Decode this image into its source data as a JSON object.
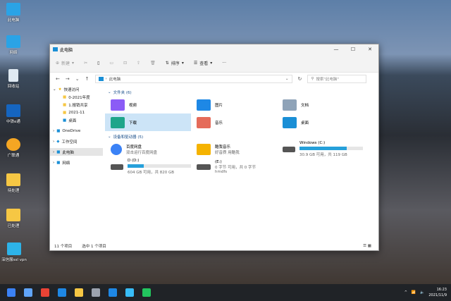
{
  "desktop": {
    "icons": [
      {
        "label": "此电脑",
        "color": "#2aa3e6"
      },
      {
        "label": "网络",
        "color": "#2aa3e6"
      },
      {
        "label": "回收站",
        "color": "#dfe9f2"
      },
      {
        "label": "中铁e通",
        "color": "#1565c0"
      },
      {
        "label": "广联通",
        "color": "#f5a623"
      },
      {
        "label": "待处理",
        "color": "#f6c744"
      },
      {
        "label": "已处理",
        "color": "#f6c744"
      },
      {
        "label": "深信服ssl vpn",
        "color": "#2db3e8"
      }
    ]
  },
  "window": {
    "title": "此电脑",
    "controls": [
      "—",
      "☐",
      "✕"
    ]
  },
  "toolbar": {
    "new": "新建",
    "sort": "排序",
    "view": "查看",
    "more": "···"
  },
  "address": {
    "path": "此电脑",
    "search_placeholder": "搜索\"此电脑\""
  },
  "sidebar": {
    "items": [
      {
        "label": "快速访问"
      },
      {
        "label": "0-2021年度"
      },
      {
        "label": "1.报销共享"
      },
      {
        "label": "2021-11"
      },
      {
        "label": "桌面"
      },
      {
        "label": "OneDrive"
      },
      {
        "label": "工作空间"
      },
      {
        "label": "此电脑"
      },
      {
        "label": "网络"
      }
    ]
  },
  "folders": {
    "header": "文件夹 (6)",
    "items": [
      {
        "label": "视频",
        "color": "#8b5cf6"
      },
      {
        "label": "图片",
        "color": "#1e88e5"
      },
      {
        "label": "文档",
        "color": "#8fa3b8"
      },
      {
        "label": "下载",
        "color": "#1ea58a"
      },
      {
        "label": "音乐",
        "color": "#e56b5a"
      },
      {
        "label": "桌面",
        "color": "#1a8fd6"
      }
    ]
  },
  "devices": {
    "header": "设备和驱动器 (5)",
    "items": [
      {
        "label": "百度网盘",
        "sub": "双击运行百度网盘",
        "color": "#3b82f6"
      },
      {
        "label": "酷我音乐",
        "sub": "好音质 用酷我",
        "color": "#f5b301"
      },
      {
        "label": "Windows (C:)",
        "sub": "30.9 GB 可用，共 119 GB",
        "used": 0.74,
        "color": "#555"
      },
      {
        "label": "D (D:)",
        "sub": "604 GB 可用，共 820 GB",
        "used": 0.26,
        "color": "#555"
      },
      {
        "label": "(E:)",
        "sub": "0 字节 可用，共 0 字节",
        "sub2": "hmdfs",
        "color": "#555"
      }
    ]
  },
  "status": {
    "count": "11 个项目",
    "selected": "选中 1 个项目"
  },
  "taskbar": {
    "apps": [
      "#3b82f6",
      "#60a5fa",
      "#ea4335",
      "#1e88e5",
      "#f6c744",
      "#9ca3af",
      "#1e88e5",
      "#38bdf8",
      "#22c55e"
    ],
    "time": "16:23",
    "date": "2021/11/9",
    "tray_chevron": "^"
  }
}
